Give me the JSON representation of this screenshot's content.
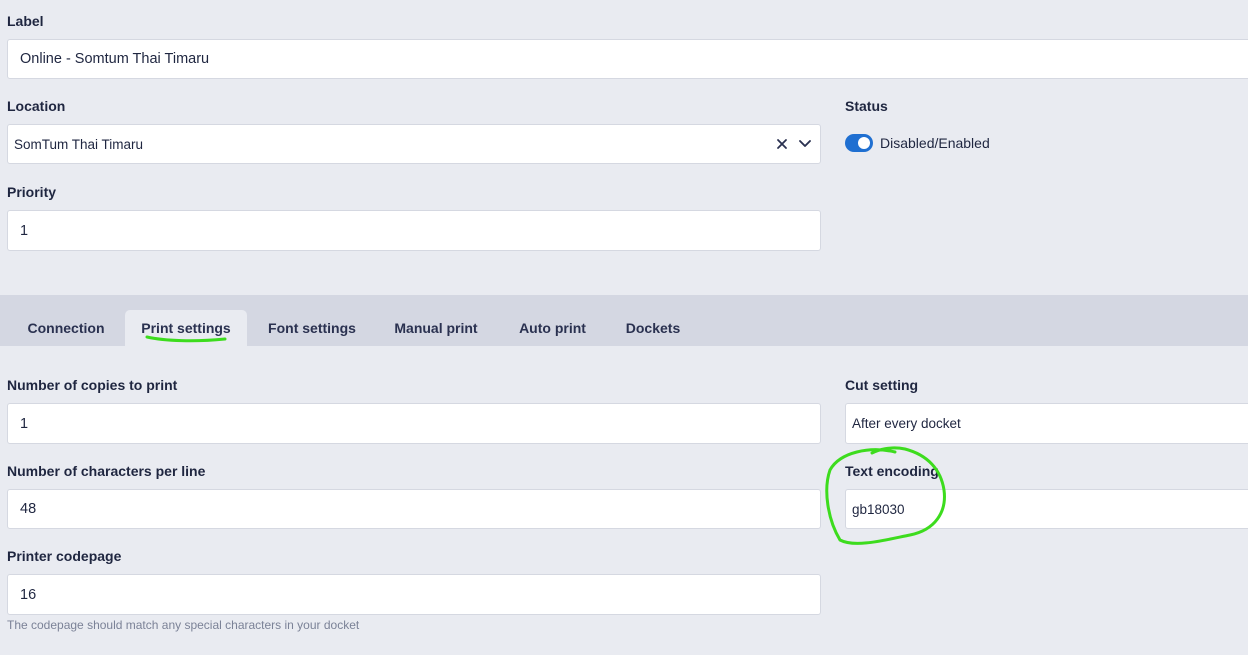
{
  "form": {
    "label": {
      "title": "Label",
      "value": "Online - Somtum Thai Timaru"
    },
    "location": {
      "title": "Location",
      "value": "SomTum Thai Timaru"
    },
    "status": {
      "title": "Status",
      "toggle_label": "Disabled/Enabled",
      "enabled": true
    },
    "priority": {
      "title": "Priority",
      "value": "1"
    }
  },
  "tabs": [
    {
      "label": "Connection"
    },
    {
      "label": "Print settings",
      "active": true
    },
    {
      "label": "Font settings"
    },
    {
      "label": "Manual print"
    },
    {
      "label": "Auto print"
    },
    {
      "label": "Dockets"
    }
  ],
  "print_settings": {
    "copies": {
      "title": "Number of copies to print",
      "value": "1"
    },
    "cut": {
      "title": "Cut setting",
      "value": "After every docket"
    },
    "chars_per_line": {
      "title": "Number of characters per line",
      "value": "48"
    },
    "text_encoding": {
      "title": "Text encoding",
      "value": "gb18030"
    },
    "codepage": {
      "title": "Printer codepage",
      "value": "16",
      "helper": "The codepage should match any special characters in your docket"
    }
  },
  "colors": {
    "accent": "#1f6fd1",
    "annotation": "#3ddc1e",
    "background": "#e9ebf1",
    "tabbar": "#d4d7e2"
  },
  "icons": {
    "clear": "close-icon",
    "dropdown": "chevron-down-icon"
  }
}
